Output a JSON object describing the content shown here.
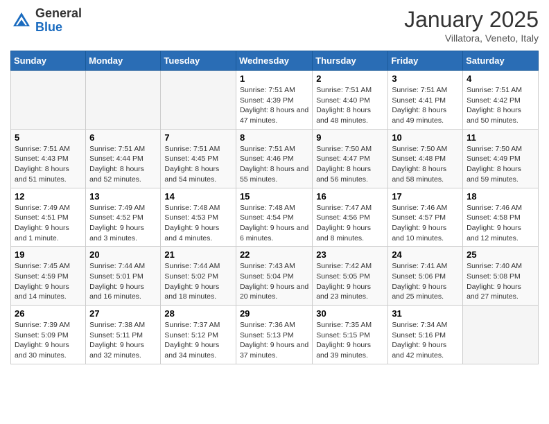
{
  "header": {
    "logo_general": "General",
    "logo_blue": "Blue",
    "month_title": "January 2025",
    "subtitle": "Villatora, Veneto, Italy"
  },
  "days_of_week": [
    "Sunday",
    "Monday",
    "Tuesday",
    "Wednesday",
    "Thursday",
    "Friday",
    "Saturday"
  ],
  "weeks": [
    [
      {
        "num": "",
        "info": ""
      },
      {
        "num": "",
        "info": ""
      },
      {
        "num": "",
        "info": ""
      },
      {
        "num": "1",
        "info": "Sunrise: 7:51 AM\nSunset: 4:39 PM\nDaylight: 8 hours and 47 minutes."
      },
      {
        "num": "2",
        "info": "Sunrise: 7:51 AM\nSunset: 4:40 PM\nDaylight: 8 hours and 48 minutes."
      },
      {
        "num": "3",
        "info": "Sunrise: 7:51 AM\nSunset: 4:41 PM\nDaylight: 8 hours and 49 minutes."
      },
      {
        "num": "4",
        "info": "Sunrise: 7:51 AM\nSunset: 4:42 PM\nDaylight: 8 hours and 50 minutes."
      }
    ],
    [
      {
        "num": "5",
        "info": "Sunrise: 7:51 AM\nSunset: 4:43 PM\nDaylight: 8 hours and 51 minutes."
      },
      {
        "num": "6",
        "info": "Sunrise: 7:51 AM\nSunset: 4:44 PM\nDaylight: 8 hours and 52 minutes."
      },
      {
        "num": "7",
        "info": "Sunrise: 7:51 AM\nSunset: 4:45 PM\nDaylight: 8 hours and 54 minutes."
      },
      {
        "num": "8",
        "info": "Sunrise: 7:51 AM\nSunset: 4:46 PM\nDaylight: 8 hours and 55 minutes."
      },
      {
        "num": "9",
        "info": "Sunrise: 7:50 AM\nSunset: 4:47 PM\nDaylight: 8 hours and 56 minutes."
      },
      {
        "num": "10",
        "info": "Sunrise: 7:50 AM\nSunset: 4:48 PM\nDaylight: 8 hours and 58 minutes."
      },
      {
        "num": "11",
        "info": "Sunrise: 7:50 AM\nSunset: 4:49 PM\nDaylight: 8 hours and 59 minutes."
      }
    ],
    [
      {
        "num": "12",
        "info": "Sunrise: 7:49 AM\nSunset: 4:51 PM\nDaylight: 9 hours and 1 minute."
      },
      {
        "num": "13",
        "info": "Sunrise: 7:49 AM\nSunset: 4:52 PM\nDaylight: 9 hours and 3 minutes."
      },
      {
        "num": "14",
        "info": "Sunrise: 7:48 AM\nSunset: 4:53 PM\nDaylight: 9 hours and 4 minutes."
      },
      {
        "num": "15",
        "info": "Sunrise: 7:48 AM\nSunset: 4:54 PM\nDaylight: 9 hours and 6 minutes."
      },
      {
        "num": "16",
        "info": "Sunrise: 7:47 AM\nSunset: 4:56 PM\nDaylight: 9 hours and 8 minutes."
      },
      {
        "num": "17",
        "info": "Sunrise: 7:46 AM\nSunset: 4:57 PM\nDaylight: 9 hours and 10 minutes."
      },
      {
        "num": "18",
        "info": "Sunrise: 7:46 AM\nSunset: 4:58 PM\nDaylight: 9 hours and 12 minutes."
      }
    ],
    [
      {
        "num": "19",
        "info": "Sunrise: 7:45 AM\nSunset: 4:59 PM\nDaylight: 9 hours and 14 minutes."
      },
      {
        "num": "20",
        "info": "Sunrise: 7:44 AM\nSunset: 5:01 PM\nDaylight: 9 hours and 16 minutes."
      },
      {
        "num": "21",
        "info": "Sunrise: 7:44 AM\nSunset: 5:02 PM\nDaylight: 9 hours and 18 minutes."
      },
      {
        "num": "22",
        "info": "Sunrise: 7:43 AM\nSunset: 5:04 PM\nDaylight: 9 hours and 20 minutes."
      },
      {
        "num": "23",
        "info": "Sunrise: 7:42 AM\nSunset: 5:05 PM\nDaylight: 9 hours and 23 minutes."
      },
      {
        "num": "24",
        "info": "Sunrise: 7:41 AM\nSunset: 5:06 PM\nDaylight: 9 hours and 25 minutes."
      },
      {
        "num": "25",
        "info": "Sunrise: 7:40 AM\nSunset: 5:08 PM\nDaylight: 9 hours and 27 minutes."
      }
    ],
    [
      {
        "num": "26",
        "info": "Sunrise: 7:39 AM\nSunset: 5:09 PM\nDaylight: 9 hours and 30 minutes."
      },
      {
        "num": "27",
        "info": "Sunrise: 7:38 AM\nSunset: 5:11 PM\nDaylight: 9 hours and 32 minutes."
      },
      {
        "num": "28",
        "info": "Sunrise: 7:37 AM\nSunset: 5:12 PM\nDaylight: 9 hours and 34 minutes."
      },
      {
        "num": "29",
        "info": "Sunrise: 7:36 AM\nSunset: 5:13 PM\nDaylight: 9 hours and 37 minutes."
      },
      {
        "num": "30",
        "info": "Sunrise: 7:35 AM\nSunset: 5:15 PM\nDaylight: 9 hours and 39 minutes."
      },
      {
        "num": "31",
        "info": "Sunrise: 7:34 AM\nSunset: 5:16 PM\nDaylight: 9 hours and 42 minutes."
      },
      {
        "num": "",
        "info": ""
      }
    ]
  ]
}
